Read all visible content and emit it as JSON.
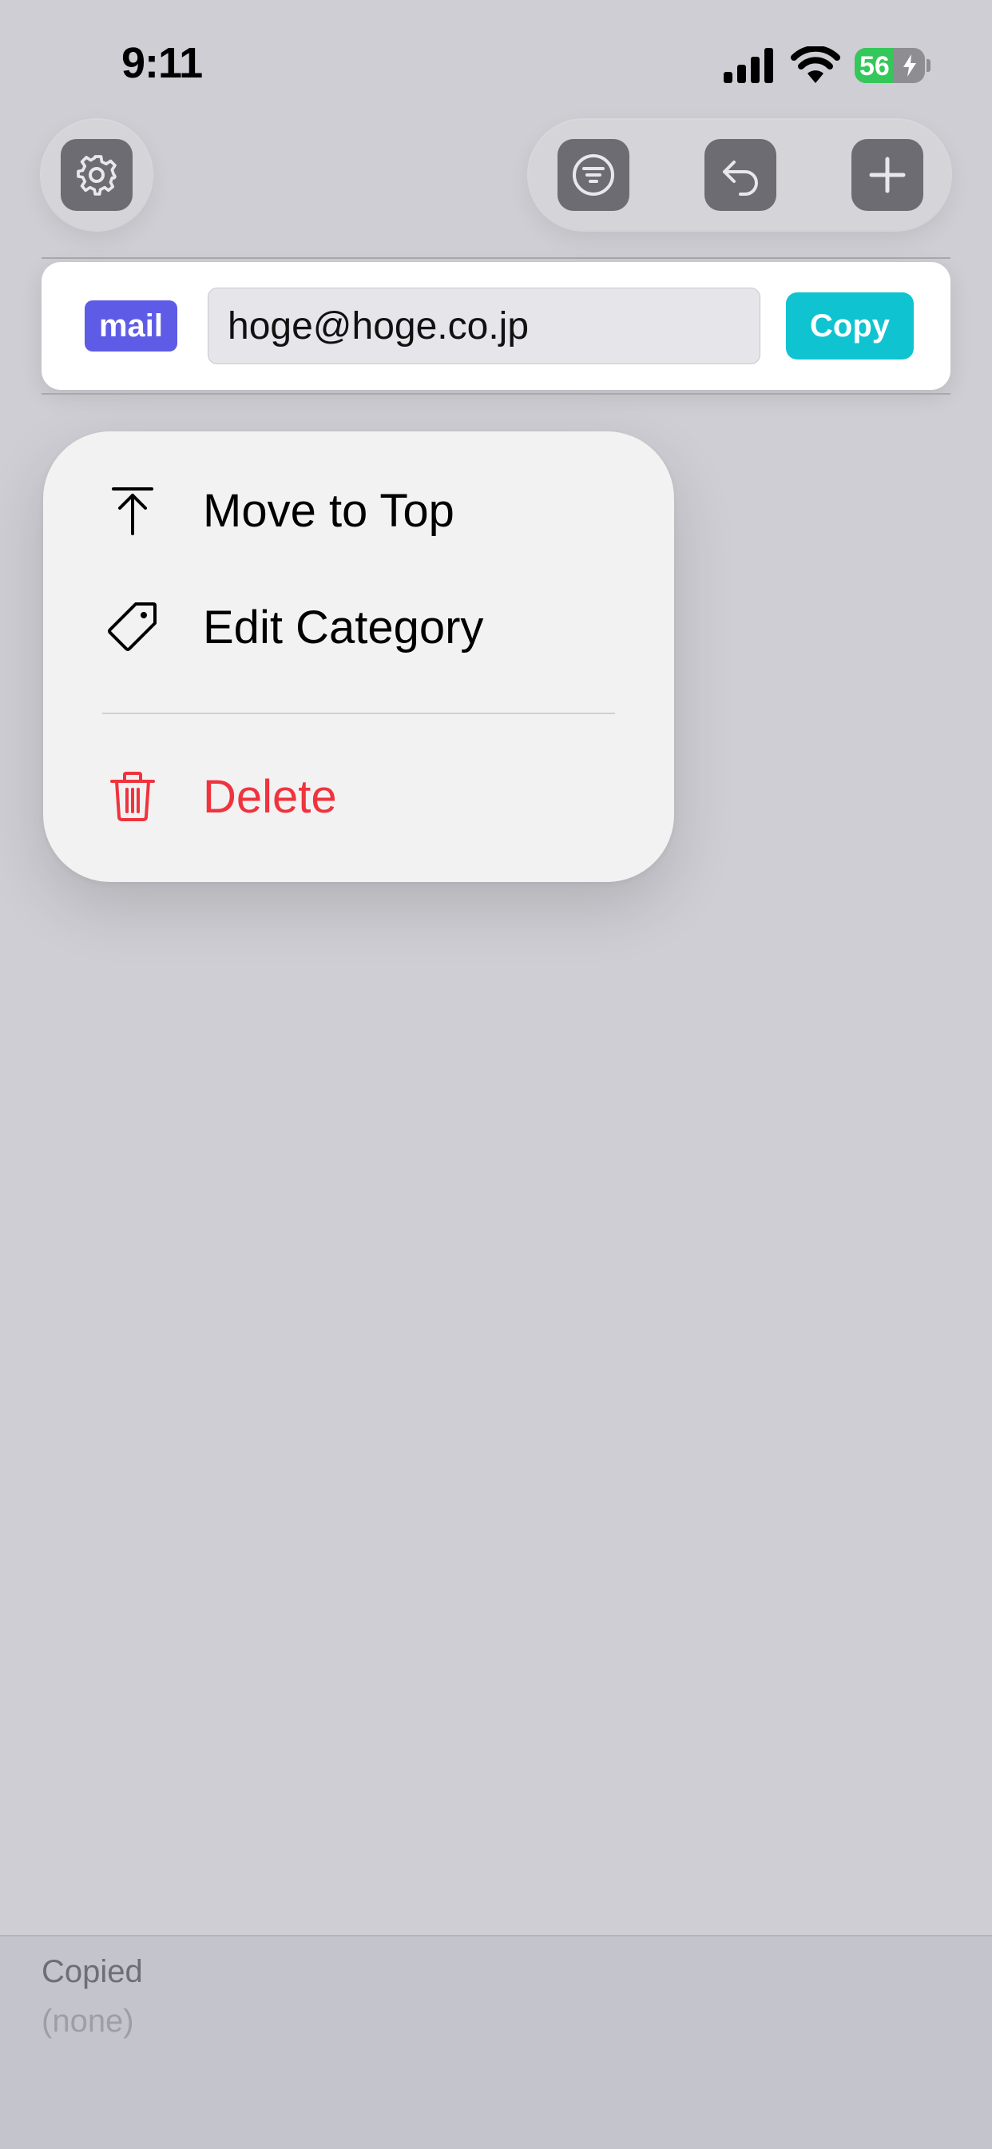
{
  "status_bar": {
    "time": "9:11",
    "battery_level": "56",
    "battery_fill_percent": 56,
    "battery_charging": true
  },
  "toolbar": {
    "settings_icon": "gear-icon",
    "filter_icon": "filter-icon",
    "undo_icon": "undo-icon",
    "add_icon": "plus-icon"
  },
  "entry": {
    "category": "mail",
    "category_color": "#5e5ce6",
    "value": "hoge@hoge.co.jp",
    "copy_label": "Copy",
    "copy_color": "#0fc3d1"
  },
  "context_menu": {
    "items": [
      {
        "label": "Move to Top",
        "icon": "arrow-up-to-line-icon"
      },
      {
        "label": "Edit Category",
        "icon": "tag-icon"
      },
      {
        "label": "Delete",
        "icon": "trash-icon",
        "destructive": true
      }
    ],
    "destructive_color": "#f0333d"
  },
  "copied_panel": {
    "title": "Copied",
    "value": "(none)"
  }
}
